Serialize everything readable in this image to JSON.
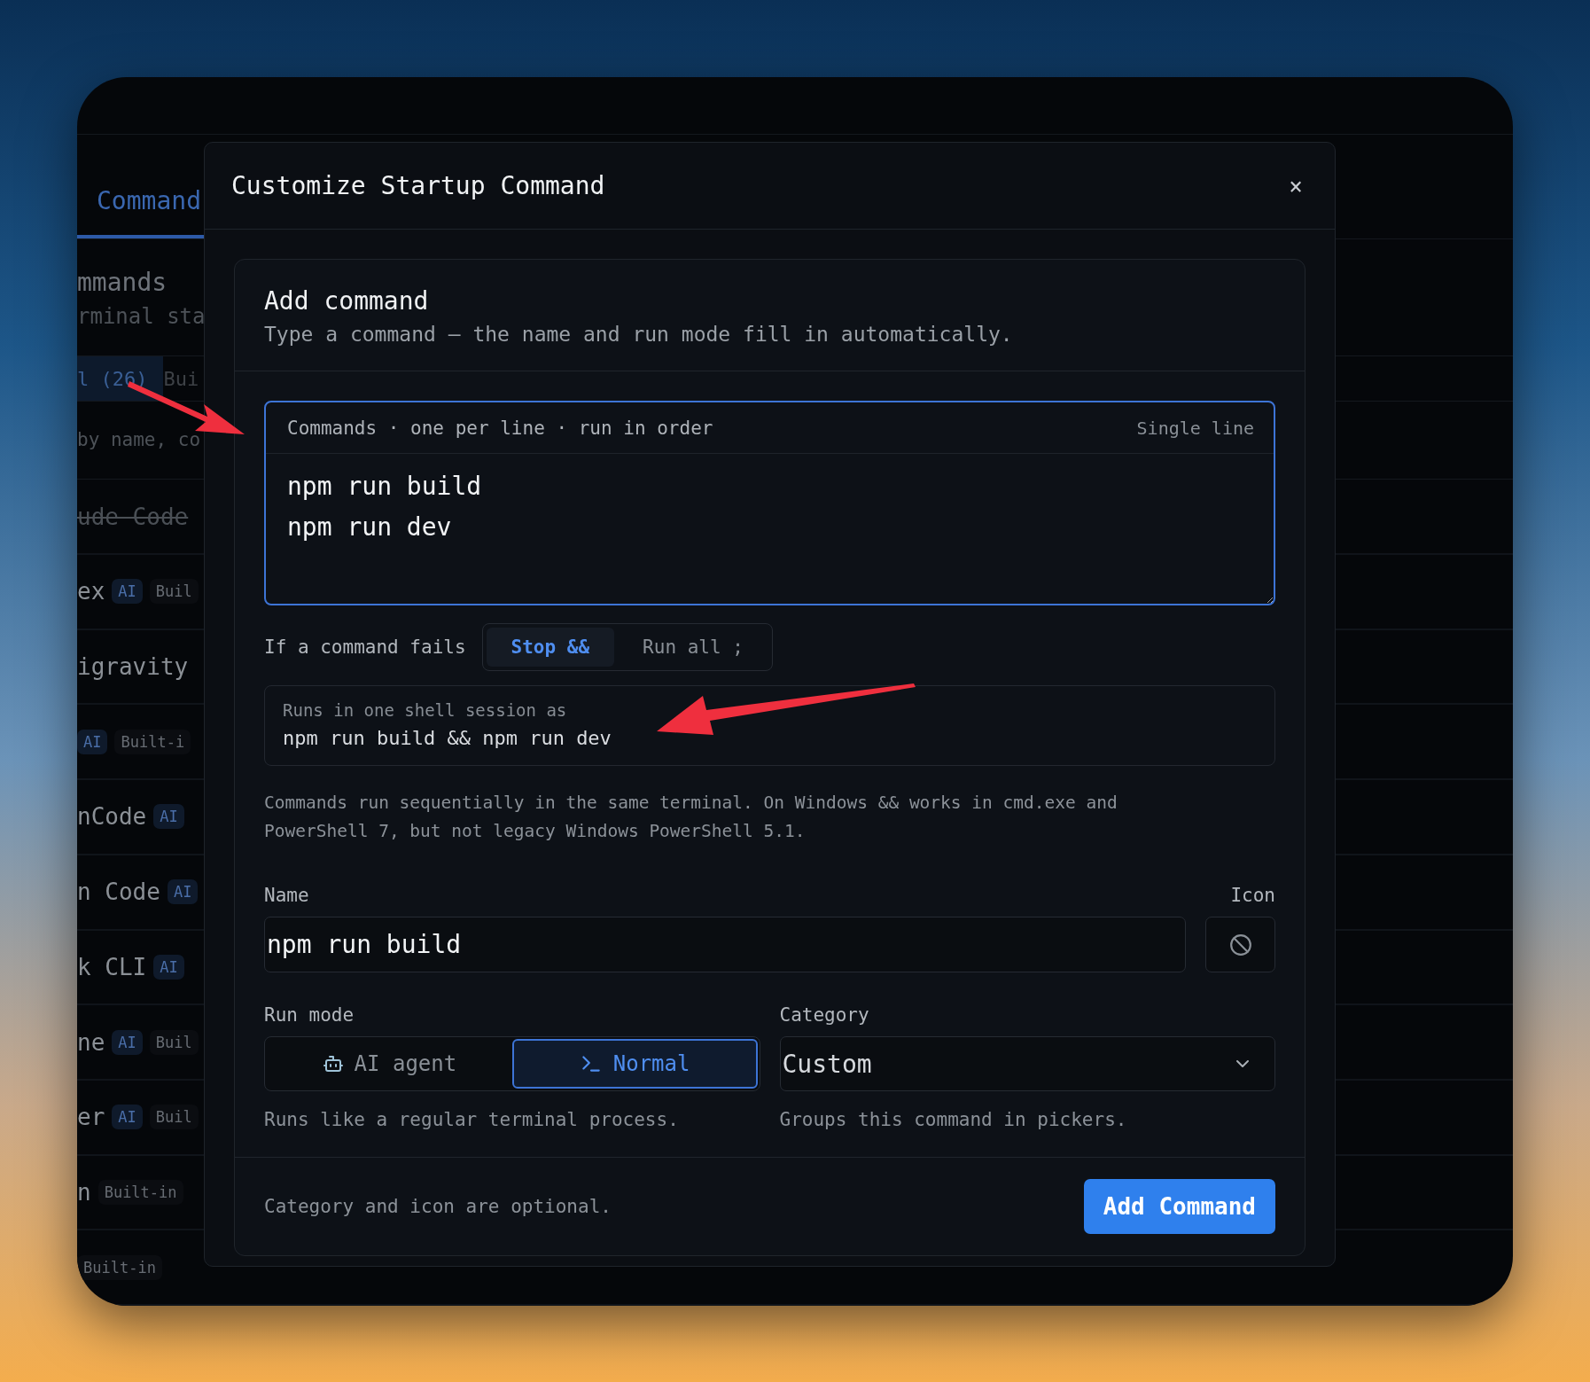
{
  "background_panel": {
    "tab": {
      "label": "Command",
      "selected": true
    },
    "heading": "mmands",
    "subheading": "rminal sta",
    "filters": [
      {
        "label": "l (26)",
        "selected": true
      },
      {
        "label": "Bui",
        "selected": false
      }
    ],
    "search": {
      "placeholder": "by name, co"
    },
    "items": [
      {
        "name": "ude Code",
        "disabled": true
      },
      {
        "name": "ex",
        "disabled": false,
        "badges": [
          {
            "kind": "ai",
            "label": "AI"
          },
          {
            "kind": "builtin",
            "label": "Buil"
          }
        ]
      },
      {
        "name": "igravity",
        "disabled": false
      },
      {
        "disabled": false,
        "badges": [
          {
            "kind": "ai",
            "label": "AI"
          },
          {
            "kind": "builtin",
            "label": "Built-i"
          }
        ]
      },
      {
        "name": "nCode",
        "disabled": false,
        "badges": [
          {
            "kind": "ai",
            "label": "AI"
          }
        ]
      },
      {
        "name": "n Code",
        "disabled": false,
        "badges": [
          {
            "kind": "ai",
            "label": "AI"
          }
        ]
      },
      {
        "name": "k CLI",
        "disabled": false,
        "badges": [
          {
            "kind": "ai",
            "label": "AI"
          }
        ]
      },
      {
        "name": "ne",
        "disabled": false,
        "badges": [
          {
            "kind": "ai",
            "label": "AI"
          },
          {
            "kind": "builtin",
            "label": "Buil"
          }
        ]
      },
      {
        "name": "er",
        "disabled": false,
        "badges": [
          {
            "kind": "ai",
            "label": "AI"
          },
          {
            "kind": "builtin",
            "label": "Buil"
          }
        ]
      },
      {
        "name": "n",
        "disabled": false,
        "badges": [
          {
            "kind": "builtin",
            "label": "Built-in"
          }
        ]
      },
      {
        "disabled": false,
        "badges": [
          {
            "kind": "builtin",
            "label": "Built-in"
          }
        ]
      }
    ]
  },
  "dialog": {
    "title": "Customize Startup Command",
    "close": "×",
    "card": {
      "title": "Add command",
      "subtitle": "Type a command — the name and run mode fill in automatically.",
      "commands_editor": {
        "label": "Commands · one per line · run in order",
        "toggle": "Single line",
        "lines": [
          "npm run build",
          "npm run dev"
        ]
      },
      "on_failure": {
        "label": "If a command fails",
        "options": [
          {
            "label": "Stop &&",
            "selected": true
          },
          {
            "label": "Run all ;",
            "selected": false
          }
        ]
      },
      "preview": {
        "caption": "Runs in one shell session as",
        "command": "npm run build && npm run dev"
      },
      "note": "Commands run sequentially in the same terminal. On Windows && works in cmd.exe and PowerShell 7, but not legacy Windows PowerShell 5.1.",
      "name_field": {
        "label": "Name",
        "value": "npm run build"
      },
      "icon_field": {
        "label": "Icon"
      },
      "run_mode": {
        "label": "Run mode",
        "options": [
          {
            "kind": "ai",
            "label": "AI agent",
            "selected": false
          },
          {
            "kind": "normal",
            "label": "Normal",
            "selected": true
          }
        ],
        "hint": "Runs like a regular terminal process."
      },
      "category": {
        "label": "Category",
        "value": "Custom",
        "hint": "Groups this command in pickers."
      },
      "footer": {
        "note": "Category and icon are optional.",
        "button": "Add Command"
      }
    }
  }
}
